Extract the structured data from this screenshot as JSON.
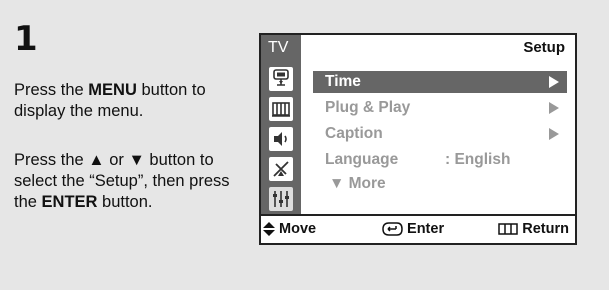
{
  "step": {
    "number": "1"
  },
  "instructions": {
    "p1": {
      "a": "Press the ",
      "b": "MENU",
      "c": " button to display the menu."
    },
    "p2": {
      "a": "Press the ",
      "up": "▲",
      "mid": " or ",
      "down": "▼",
      "b": " button to select the “Setup”, then press the ",
      "c": "ENTER",
      "d": " button."
    }
  },
  "osd": {
    "tv_label": "TV",
    "title": "Setup",
    "items": [
      {
        "label": "Time",
        "selected": true,
        "has_arrow": true,
        "value": ""
      },
      {
        "label": "Plug & Play",
        "selected": false,
        "has_arrow": true,
        "value": ""
      },
      {
        "label": "Caption",
        "selected": false,
        "has_arrow": true,
        "value": ""
      },
      {
        "label": "Language",
        "selected": false,
        "has_arrow": false,
        "value": ": English"
      }
    ],
    "more": "▼ More",
    "bottom": {
      "move": "Move",
      "enter": "Enter",
      "return": "Return"
    },
    "sidebar_icons": [
      "picture-icon",
      "channel-icon",
      "sound-icon",
      "antenna-icon",
      "setup-icon"
    ]
  },
  "colors": {
    "panel": "#666666",
    "background": "#e6e6e6",
    "text": "#111111",
    "muted": "#999999"
  }
}
